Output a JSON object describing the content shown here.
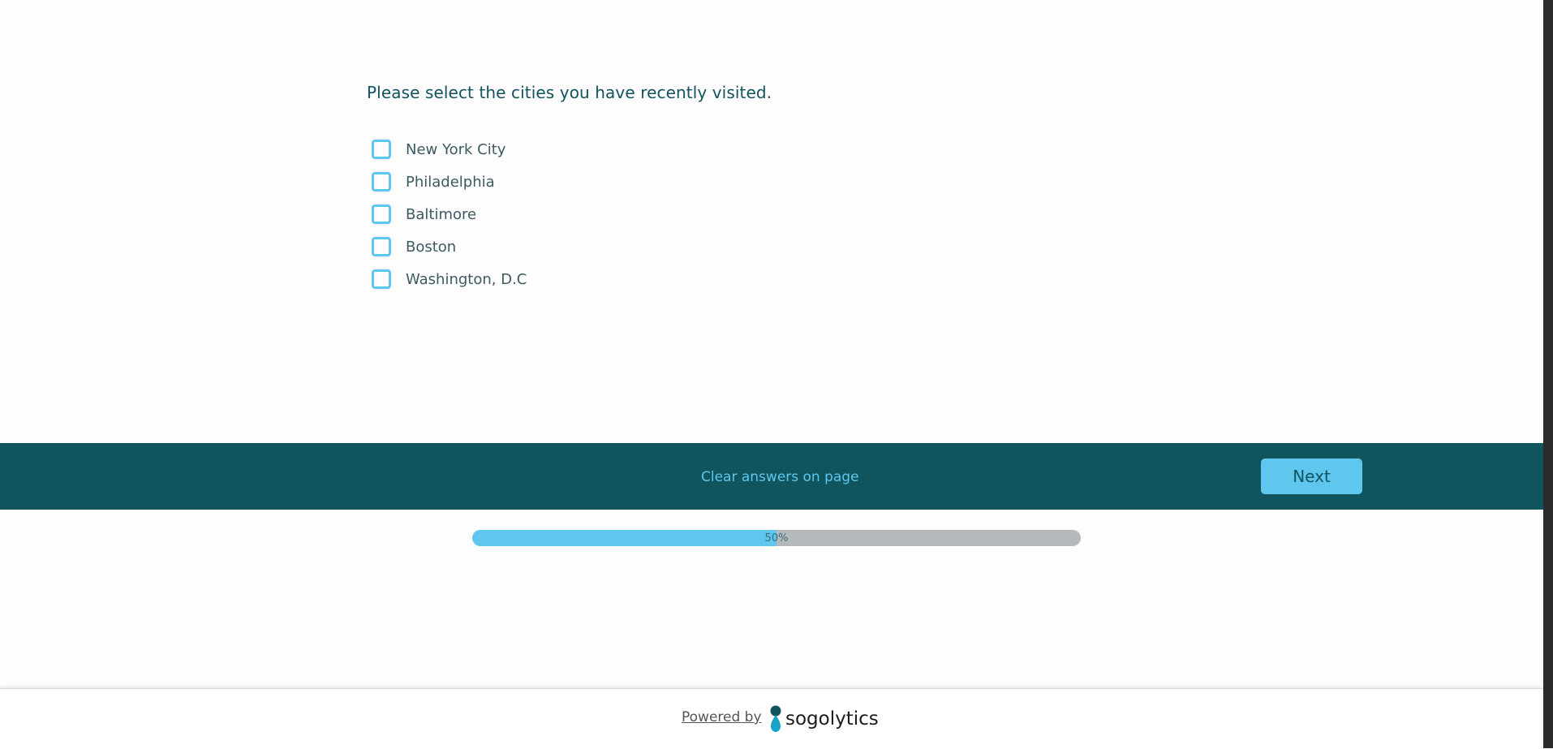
{
  "question": {
    "text": "Please select the cities you have recently visited."
  },
  "options": [
    {
      "label": "New York City",
      "checked": false
    },
    {
      "label": "Philadelphia",
      "checked": false
    },
    {
      "label": "Baltimore",
      "checked": false
    },
    {
      "label": "Boston",
      "checked": false
    },
    {
      "label": "Washington, D.C",
      "checked": false
    }
  ],
  "nav": {
    "clear_label": "Clear answers on page",
    "next_label": "Next"
  },
  "progress": {
    "percent": 50,
    "label": "50%"
  },
  "footer": {
    "powered_by": "Powered by",
    "brand_name": "sogolytics",
    "brand_logo_icon": "sogolytics-logo-icon"
  },
  "colors": {
    "primary_dark": "#10545e",
    "accent": "#5fc6ee",
    "progress_track": "#b5b9bc"
  }
}
